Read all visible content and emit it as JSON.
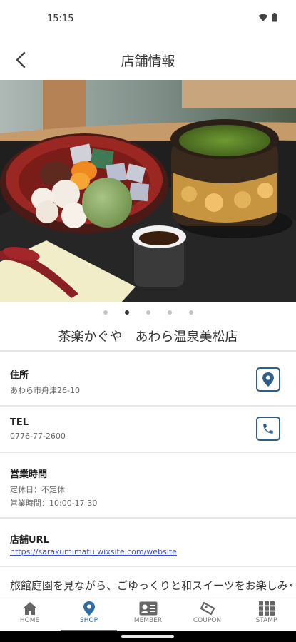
{
  "status_bar": {
    "time": "15:15",
    "icons": [
      "wifi-icon",
      "battery-icon"
    ]
  },
  "header": {
    "title": "店舗情報",
    "back_icon": "back-arrow-icon"
  },
  "carousel": {
    "slides": 5,
    "active_index": 1
  },
  "shop": {
    "name": "茶楽かぐや　あわら温泉美松店",
    "address_label": "住所",
    "address": "あわら市舟津26-10",
    "tel_label": "TEL",
    "tel": "0776-77-2600",
    "hours_label": "営業時間",
    "closed": "定休日：不定休",
    "hours": "営業時間：10:00-17:30",
    "url_label": "店舗URL",
    "url": "https://sarakumimatu.wixsite.com/website",
    "description": "旅館庭園を見ながら、ごゆっくりと和スイーツをお楽しみください"
  },
  "nav": {
    "items": [
      {
        "label": "HOME",
        "icon": "home-icon"
      },
      {
        "label": "SHOP",
        "icon": "location-pin-icon",
        "active": true
      },
      {
        "label": "MEMBER",
        "icon": "member-card-icon"
      },
      {
        "label": "COUPON",
        "icon": "coupon-ticket-icon"
      },
      {
        "label": "STAMP",
        "icon": "stamp-grid-icon"
      }
    ]
  },
  "colors": {
    "accent": "#2f6ea5",
    "button_border": "#2d5f8a",
    "link": "#3b50c8"
  }
}
